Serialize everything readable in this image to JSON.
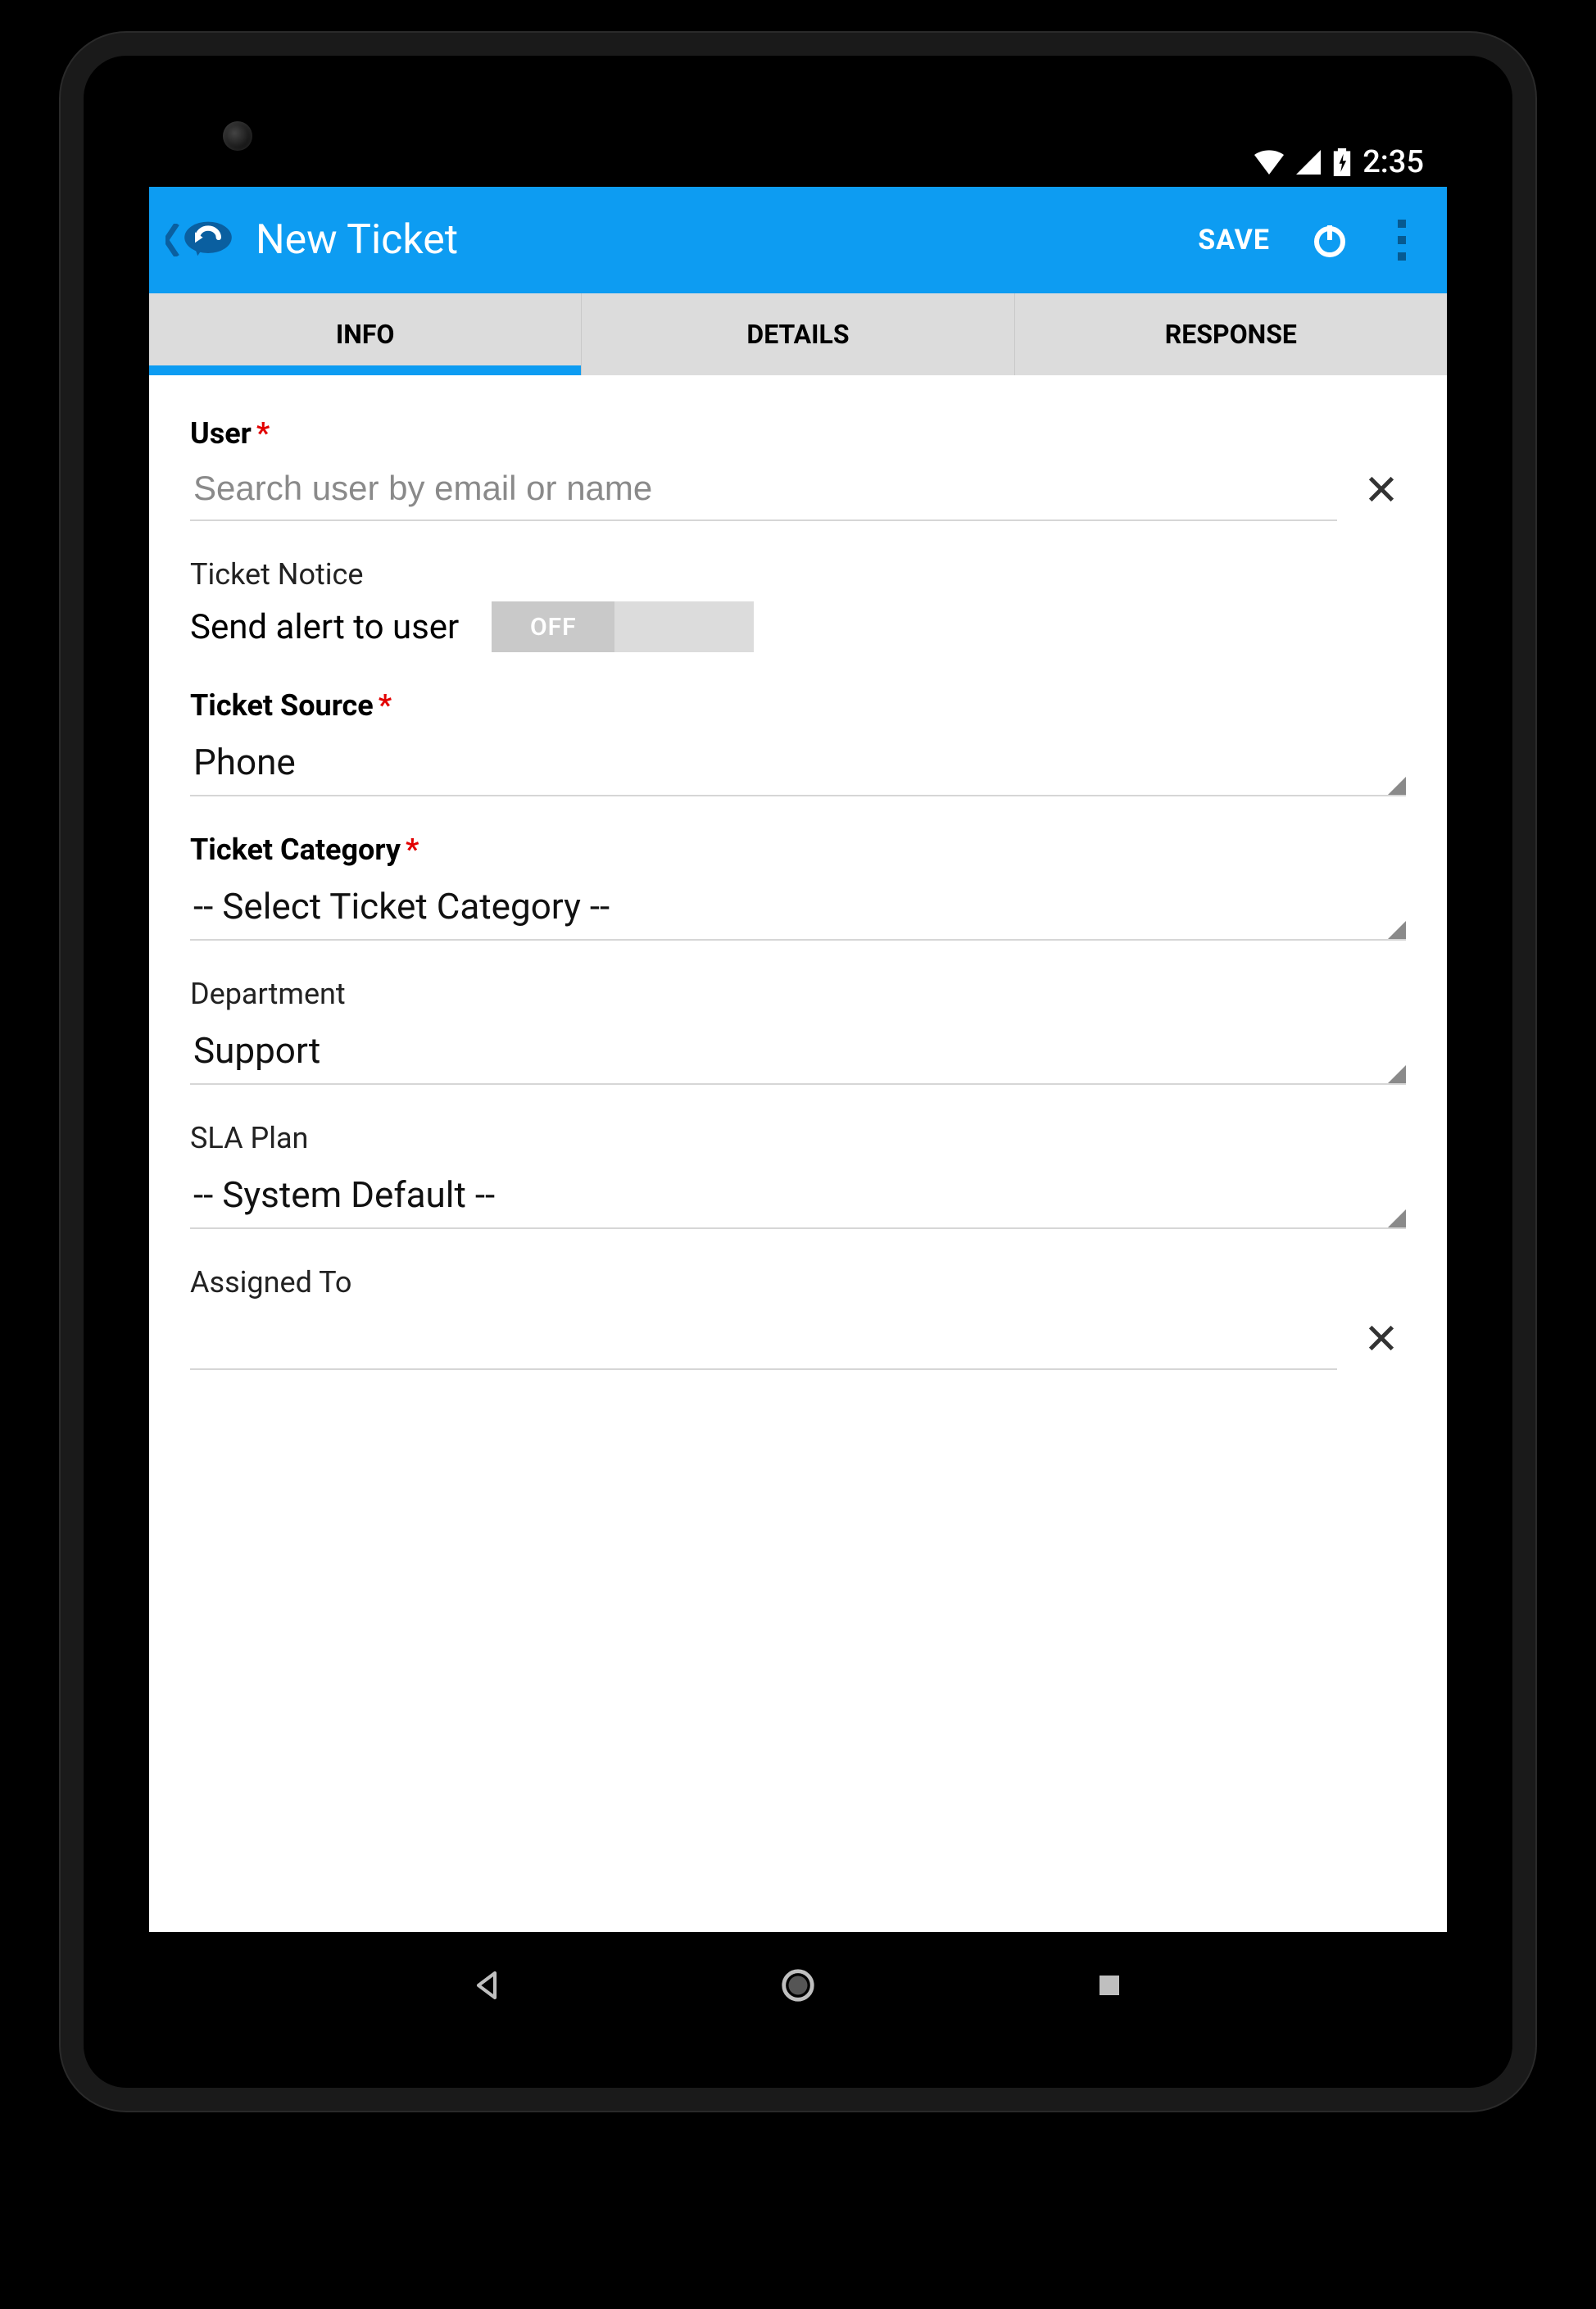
{
  "statusbar": {
    "time": "2:35"
  },
  "appbar": {
    "title": "New Ticket",
    "save": "SAVE"
  },
  "tabs": {
    "info": "INFO",
    "details": "DETAILS",
    "response": "RESPONSE"
  },
  "form": {
    "user": {
      "label": "User",
      "placeholder": "Search user by email or name",
      "value": ""
    },
    "notice": {
      "label": "Ticket Notice",
      "text": "Send alert to user",
      "toggle": "OFF"
    },
    "source": {
      "label": "Ticket Source",
      "value": "Phone"
    },
    "category": {
      "label": "Ticket Category",
      "value": "-- Select Ticket Category --"
    },
    "department": {
      "label": "Department",
      "value": "Support"
    },
    "sla": {
      "label": "SLA Plan",
      "value": "-- System Default --"
    },
    "assigned": {
      "label": "Assigned To",
      "value": ""
    }
  }
}
